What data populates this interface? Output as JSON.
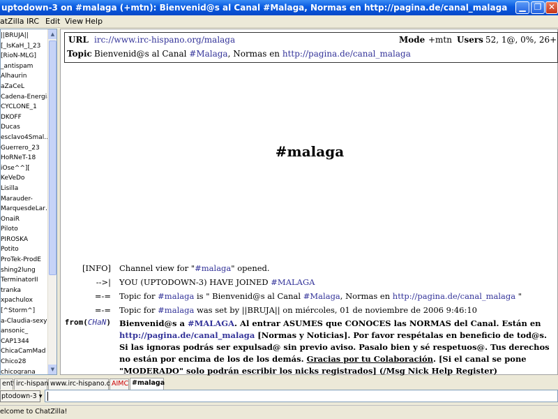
{
  "window": {
    "title": "uptodown-3 on #malaga (+mtn):  Bienvenid@s al Canal #Malaga, Normas en http://pagina.de/canal_malaga"
  },
  "menu": [
    "atZilla",
    "IRC",
    "Edit",
    "View",
    "Help"
  ],
  "userlist": [
    "||BRUJA||",
    "[_IsKaH_]_23",
    "[RioN-MLG]",
    "_antispam",
    "Alhaurin",
    "aZaCeL",
    "Cadena-Energia",
    "CYCLONE_1",
    "DKOFF",
    "Ducas",
    "esclavo4Smal…",
    "Guerrero_23",
    "HoRNeT-18",
    "iOse^^][",
    "KeVeDo",
    "Lisilla",
    "Marauder-",
    "MarquesdeLar…",
    "OnaiR",
    "Piloto",
    "PIROSKA",
    "Potito",
    "ProTek-ProdE",
    "shing2lung",
    "TerminatorII",
    "tranka",
    "xpachulox",
    "[^Storm^]",
    "a-Claudia-sexy",
    "ansonic_",
    "CAP1344",
    "ChicaCamMad",
    "Chico28",
    "chicograna"
  ],
  "header": {
    "url_label": "URL",
    "url_value": "irc://www.irc-hispano.org/malaga",
    "mode_label": "Mode",
    "mode_value": "+mtn",
    "users_label": "Users",
    "users_value": "52, 1@, 0%, 26+",
    "topic_label": "Topic",
    "topic_text": "Bienvenid@s al Canal ",
    "topic_chan": "#Malaga",
    "topic_mid": ", Normas en ",
    "topic_link": "http://pagina.de/canal_malaga"
  },
  "channel_title": "#malaga",
  "messages": {
    "m1_nick": "[INFO]",
    "m1_text_a": "Channel view for \"",
    "m1_chan": "#malaga",
    "m1_text_b": "\" opened.",
    "m2_nick": "-->|",
    "m2_text": "YOU (UPTODOWN-3) HAVE JOINED ",
    "m2_chan": "#MALAGA",
    "m3_nick": "=-=",
    "m3_a": "Topic for ",
    "m3_chan": "#malaga",
    "m3_b": " is \" Bienvenid@s al Canal ",
    "m3_chan2": "#Malaga",
    "m3_c": ", Normas en ",
    "m3_link": "http://pagina.de/canal_malaga",
    "m3_d": " \"",
    "m4_nick": "=-=",
    "m4_a": "Topic for ",
    "m4_chan": "#malaga",
    "m4_b": " was set by ||BRUJA|| on miércoles, 01 de noviembre de 2006 9:46:10",
    "m5_nick_from": "from(",
    "m5_nick": "CHaN",
    "m5_nick_close": ")",
    "m5_a": "Bienvenid@s a ",
    "m5_chan": "#MALAGA",
    "m5_b": ". Al entrar ASUMES que CONOCES las NORMAS del Canal. Están en ",
    "m5_link": "http://pagina.de/canal_malaga",
    "m5_c": " [Normas y Noticias]. Por favor respétalas en beneficio de tod@s. Si las ignoras podrás ser expulsad@ sin previo aviso. Pasalo bien y sé respetuos@. Tus derechos no están por encima de los de los demás. ",
    "m5_u": "Gracias por tu Colaboración",
    "m5_d": ". [Si el canal se pone \"MODERADO\" solo podrán escribir los nicks registrados] (/Msg Nick Help Register)"
  },
  "tabs": [
    "ent*",
    "irc-hispano",
    "www.irc-hispano.org",
    "AIMC",
    "#malaga"
  ],
  "input": {
    "nick": "ptodown-3",
    "value": ""
  },
  "status": "elcome to ChatZilla!",
  "colors": {
    "link": "#333399",
    "titlebar": "#0a5be0",
    "alert_tab": "#cc0000"
  }
}
